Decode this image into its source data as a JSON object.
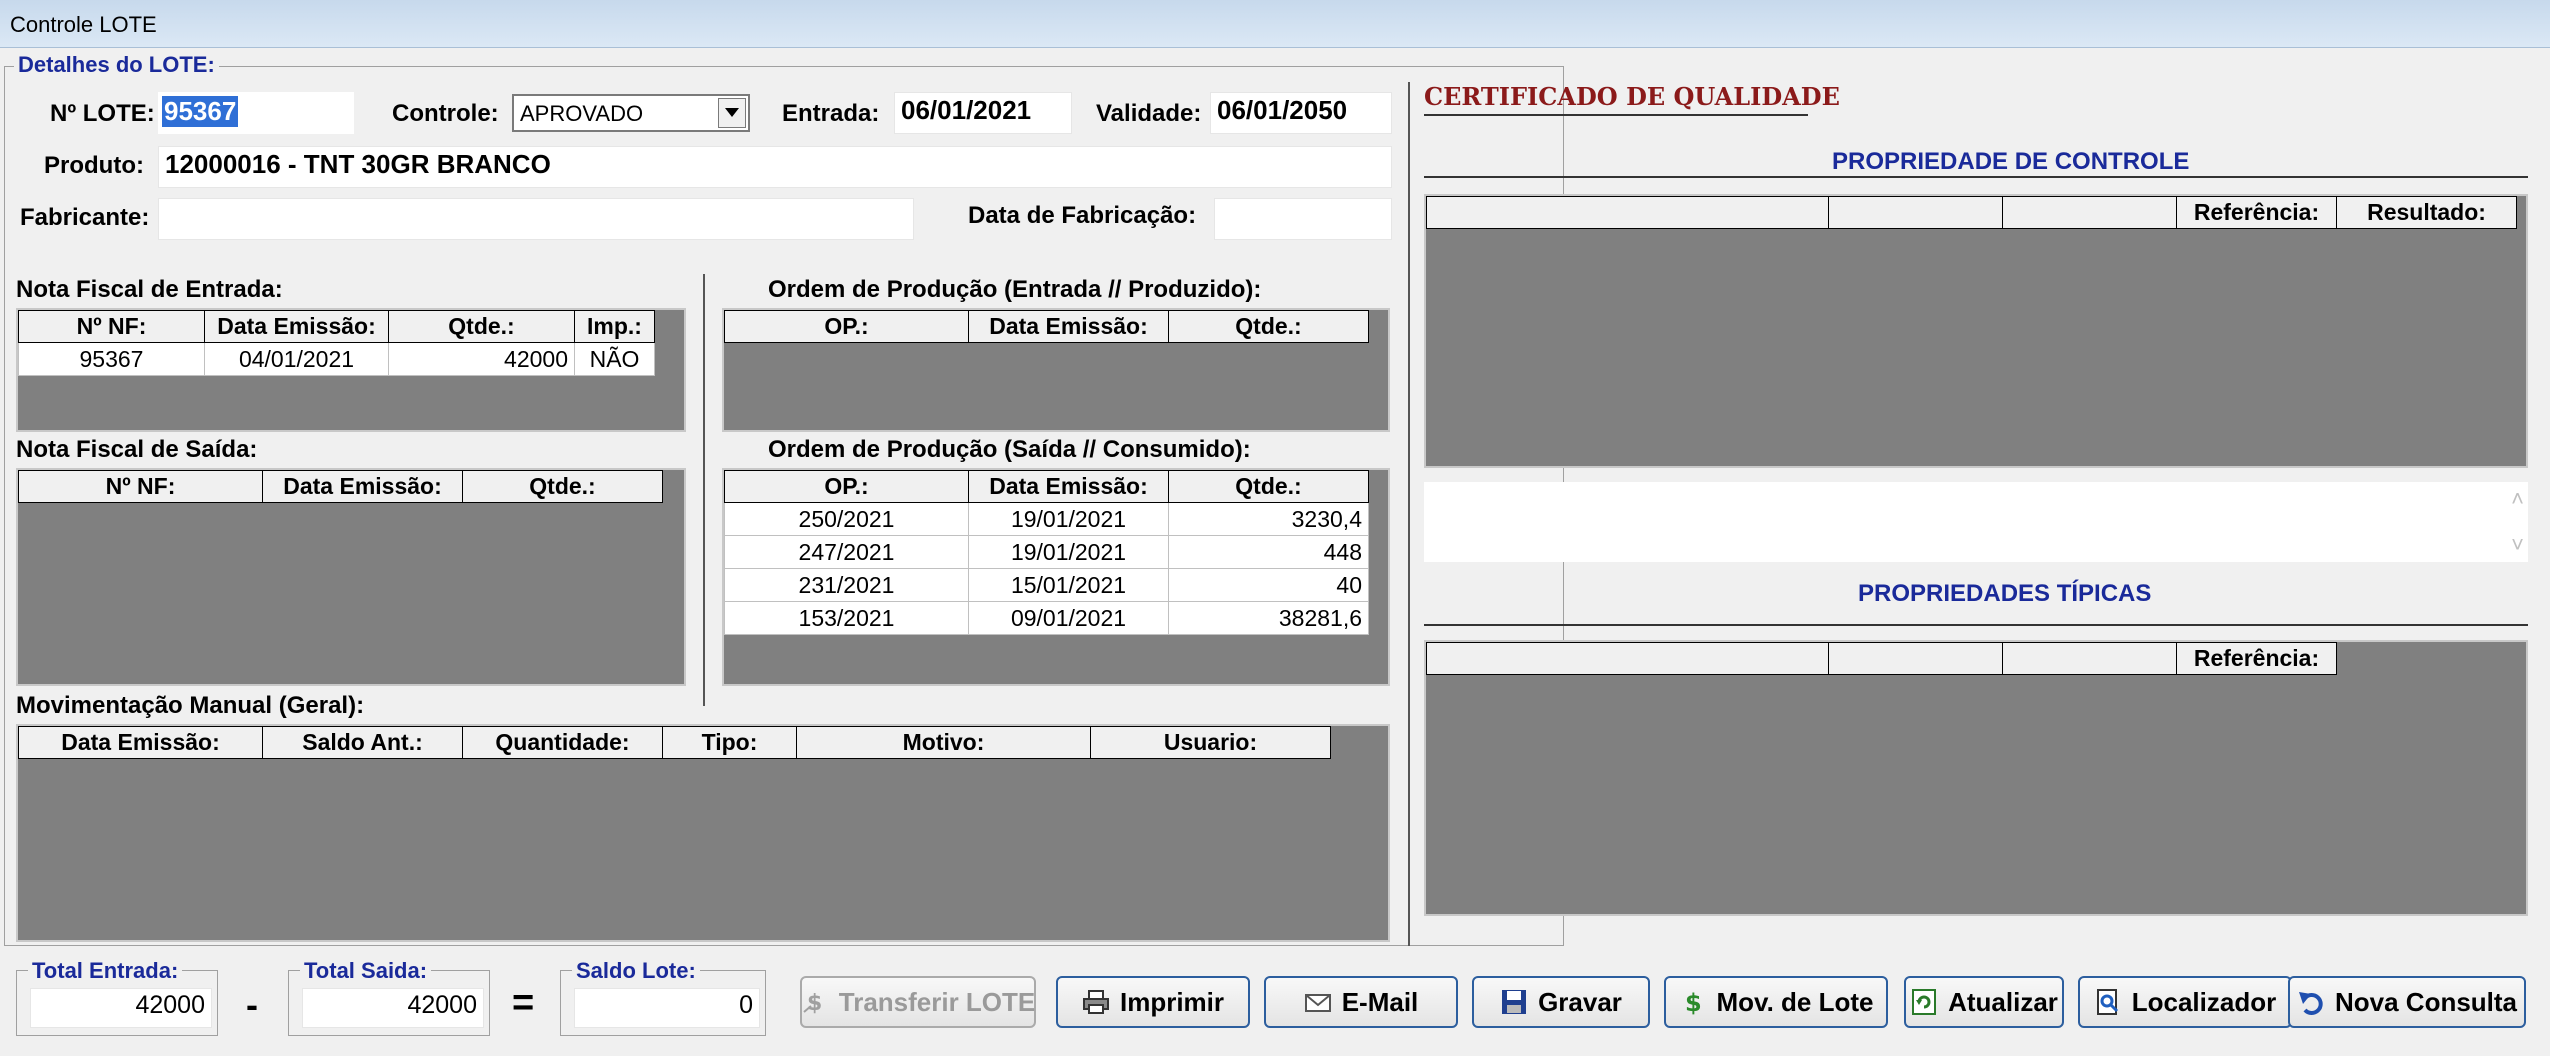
{
  "window": {
    "title": "Controle LOTE"
  },
  "details": {
    "group_title": "Detalhes do LOTE:",
    "lote_label": "Nº LOTE:",
    "lote_value": "95367",
    "controle_label": "Controle:",
    "controle_value": "APROVADO",
    "entrada_label": "Entrada:",
    "entrada_value": "06/01/2021",
    "validade_label": "Validade:",
    "validade_value": "06/01/2050",
    "produto_label": "Produto:",
    "produto_value": "12000016 - TNT 30GR  BRANCO",
    "fabricante_label": "Fabricante:",
    "fabricante_value": "",
    "data_fab_label": "Data de Fabricação:",
    "data_fab_value": ""
  },
  "nf_entrada": {
    "title": "Nota Fiscal de Entrada:",
    "headers": [
      "Nº NF:",
      "Data Emissão:",
      "Qtde.:",
      "Imp.:"
    ],
    "rows": [
      [
        "95367",
        "04/01/2021",
        "42000",
        "NÃO"
      ]
    ]
  },
  "nf_saida": {
    "title": "Nota Fiscal de Saída:",
    "headers": [
      "Nº NF:",
      "Data Emissão:",
      "Qtde.:"
    ]
  },
  "op_entrada": {
    "title": "Ordem de Produção (Entrada // Produzido):",
    "headers": [
      "OP.:",
      "Data Emissão:",
      "Qtde.:"
    ]
  },
  "op_saida": {
    "title": "Ordem de Produção (Saída // Consumido):",
    "headers": [
      "OP.:",
      "Data Emissão:",
      "Qtde.:"
    ],
    "rows": [
      [
        "250/2021",
        "19/01/2021",
        "3230,4"
      ],
      [
        "247/2021",
        "19/01/2021",
        "448"
      ],
      [
        "231/2021",
        "15/01/2021",
        "40"
      ],
      [
        "153/2021",
        "09/01/2021",
        "38281,6"
      ]
    ]
  },
  "mov_manual": {
    "title": "Movimentação Manual (Geral):",
    "headers": [
      "Data Emissão:",
      "Saldo Ant.:",
      "Quantidade:",
      "Tipo:",
      "Motivo:",
      "Usuario:"
    ]
  },
  "certificado": {
    "title": "CERTIFICADO DE QUALIDADE",
    "controle_title": "PROPRIEDADE DE CONTROLE",
    "controle_headers": [
      "",
      "",
      "",
      "Referência:",
      "Resultado:"
    ],
    "tipicas_title": "PROPRIEDADES TÍPICAS",
    "tipicas_headers": [
      "",
      "",
      "",
      "Referência:"
    ]
  },
  "totals": {
    "entrada_label": "Total Entrada:",
    "entrada_value": "42000",
    "minus": "-",
    "saida_label": "Total Saida:",
    "saida_value": "42000",
    "equals": "=",
    "saldo_label": "Saldo Lote:",
    "saldo_value": "0"
  },
  "buttons": {
    "transferir": "Transferir LOTE",
    "imprimir": "Imprimir",
    "email": "E-Mail",
    "gravar": "Gravar",
    "mov_lote": "Mov. de Lote",
    "atualizar": "Atualizar",
    "localizador": "Localizador",
    "nova_consulta": "Nova Consulta"
  },
  "colors": {
    "accent_blue": "#1a2a9a",
    "dark_red": "#8b1a1a",
    "grid_bg": "#808080"
  }
}
